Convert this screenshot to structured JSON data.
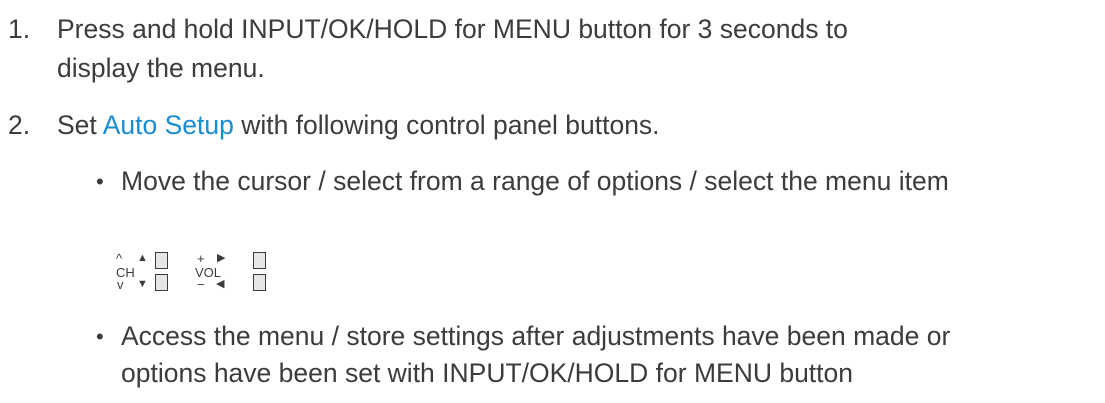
{
  "steps": [
    {
      "number": "1.",
      "line1": "Press and hold INPUT/OK/HOLD for MENU button for 3 seconds to",
      "line2": "display the menu."
    },
    {
      "number": "2.",
      "prefix": "Set ",
      "link": "Auto Setup",
      "suffix": " with following control panel buttons."
    }
  ],
  "bullets": [
    {
      "symbol": "•",
      "line1": "Move the cursor / select from a range of options / select the menu item"
    },
    {
      "symbol": "•",
      "line1": "Access the menu / store settings after adjustments have been made or",
      "line2": "options have been set with INPUT/OK/HOLD for MENU button"
    }
  ],
  "panel": {
    "ch_label": "CH",
    "vol_label": "VOL",
    "ch_up": "^",
    "ch_down": "v",
    "vol_plus": "+",
    "vol_minus": "−",
    "tri_up": "▲",
    "tri_down": "▼",
    "tri_right": "▶",
    "tri_left": "◀"
  },
  "colors": {
    "text": "#3c3c3c",
    "link": "#1a8ccf"
  }
}
